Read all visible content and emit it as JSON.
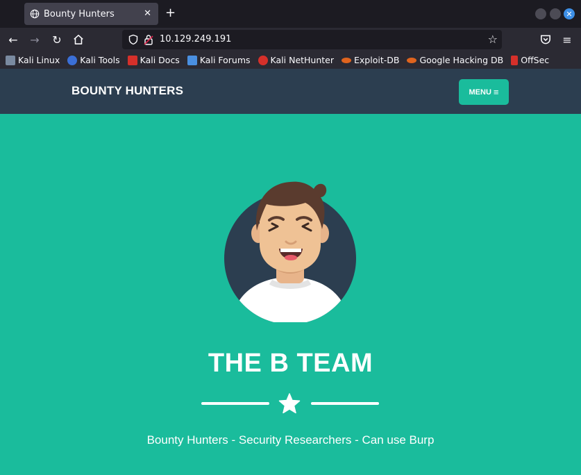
{
  "browser": {
    "tab_title": "Bounty Hunters",
    "new_tab_label": "+",
    "url": "10.129.249.191",
    "bookmarks": [
      {
        "label": "Kali Linux",
        "icon": "kali-dragon-icon",
        "color": "#7a8aa0"
      },
      {
        "label": "Kali Tools",
        "icon": "kali-tools-icon",
        "color": "#3b6fd6"
      },
      {
        "label": "Kali Docs",
        "icon": "kali-docs-icon",
        "color": "#d6302a"
      },
      {
        "label": "Kali Forums",
        "icon": "kali-forums-icon",
        "color": "#4a8fe0"
      },
      {
        "label": "Kali NetHunter",
        "icon": "kali-nethunter-icon",
        "color": "#d6302a"
      },
      {
        "label": "Exploit-DB",
        "icon": "exploit-db-icon",
        "color": "#e0641e"
      },
      {
        "label": "Google Hacking DB",
        "icon": "ghdb-icon",
        "color": "#e0641e"
      },
      {
        "label": "OffSec",
        "icon": "offsec-icon",
        "color": "#d6302a"
      }
    ]
  },
  "site": {
    "brand": "BOUNTY HUNTERS",
    "menu_label": "MENU",
    "menu_icon": "≡",
    "heading": "THE B TEAM",
    "subheading": "Bounty Hunters - Security Researchers - Can use Burp"
  },
  "colors": {
    "primary": "#1abc9c",
    "nav": "#2c3e50",
    "text": "#ffffff"
  }
}
